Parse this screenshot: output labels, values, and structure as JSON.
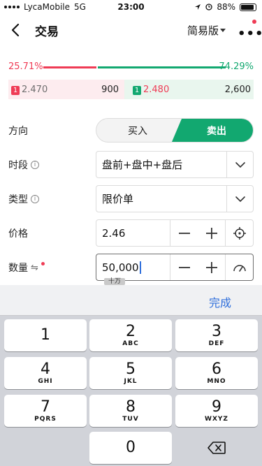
{
  "status_bar": {
    "carrier": "LycaMobile",
    "network": "5G",
    "time": "23:00",
    "battery": "88%",
    "battery_level": 0.88
  },
  "header": {
    "title": "交易",
    "mode_label": "简易版",
    "more_label": "•••"
  },
  "depth": {
    "bid_pct": "25.71%",
    "ask_pct": "74.29%",
    "bid_ratio": 0.2571,
    "ask_ratio": 0.7429
  },
  "quote": {
    "bid_tag": "1",
    "bid_price": "2.470",
    "bid_vol": "900",
    "ask_tag": "1",
    "ask_price": "2.480",
    "ask_vol": "2,600"
  },
  "form": {
    "direction_label": "方向",
    "buy_label": "买入",
    "sell_label": "卖出",
    "session_label": "时段",
    "session_value": "盘前+盘中+盘后",
    "type_label": "类型",
    "type_value": "限价单",
    "price_label": "价格",
    "price_value": "2.46",
    "qty_label": "数量",
    "qty_value": "50,000",
    "qty_hint": "十万",
    "info_glyph": "i",
    "qty_swap_glyph": "⇋"
  },
  "keyboard": {
    "done_label": "完成",
    "keys": [
      {
        "num": "1",
        "letters": ""
      },
      {
        "num": "2",
        "letters": "ABC"
      },
      {
        "num": "3",
        "letters": "DEF"
      },
      {
        "num": "4",
        "letters": "GHI"
      },
      {
        "num": "5",
        "letters": "JKL"
      },
      {
        "num": "6",
        "letters": "MNO"
      },
      {
        "num": "7",
        "letters": "PQRS"
      },
      {
        "num": "8",
        "letters": "TUV"
      },
      {
        "num": "9",
        "letters": "WXYZ"
      },
      {
        "num": "0",
        "letters": ""
      }
    ]
  },
  "colors": {
    "red": "#ef3b55",
    "green": "#12a870",
    "blue": "#2f6fdb"
  }
}
